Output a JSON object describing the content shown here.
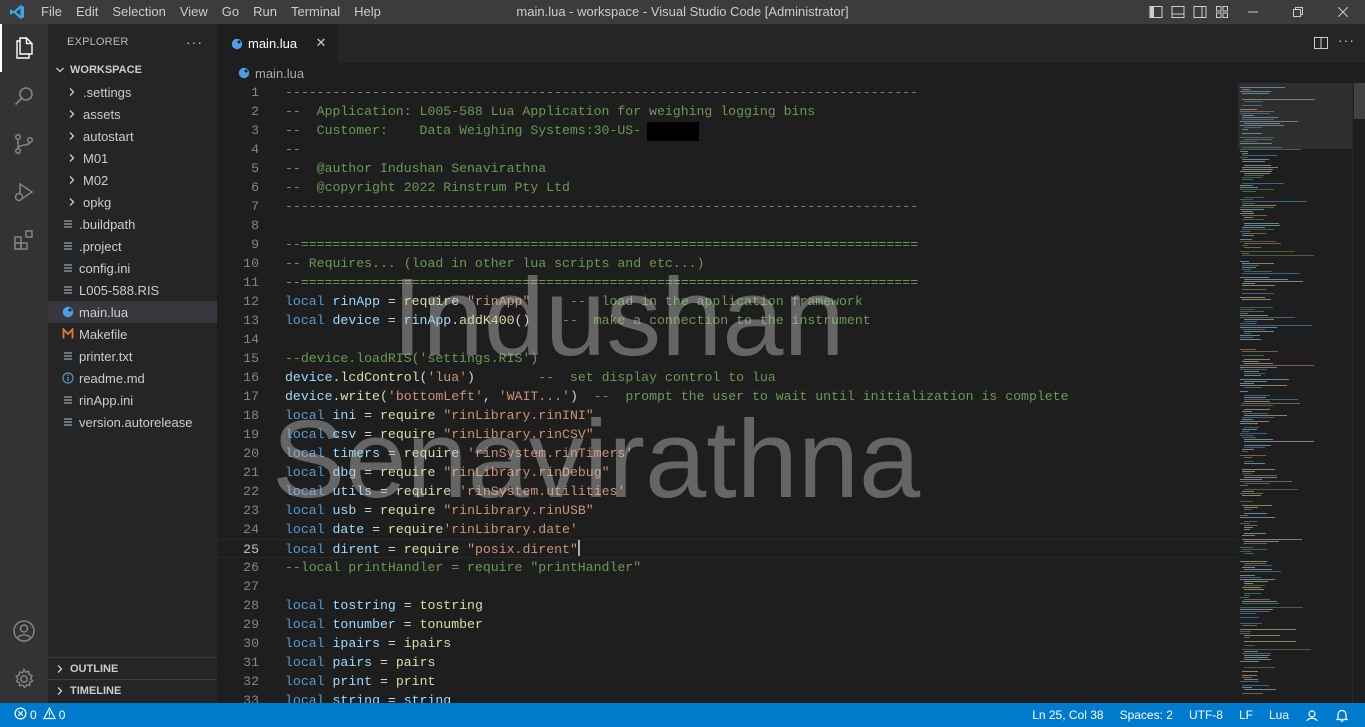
{
  "window": {
    "title": "main.lua - workspace - Visual Studio Code [Administrator]",
    "menus": [
      "File",
      "Edit",
      "Selection",
      "View",
      "Go",
      "Run",
      "Terminal",
      "Help"
    ]
  },
  "sidebar": {
    "title": "EXPLORER",
    "more": "···",
    "workspace_label": "WORKSPACE",
    "items": [
      {
        "label": ".settings",
        "kind": "folder"
      },
      {
        "label": "assets",
        "kind": "folder"
      },
      {
        "label": "autostart",
        "kind": "folder"
      },
      {
        "label": "M01",
        "kind": "folder"
      },
      {
        "label": "M02",
        "kind": "folder"
      },
      {
        "label": "opkg",
        "kind": "folder"
      },
      {
        "label": ".buildpath",
        "kind": "file"
      },
      {
        "label": ".project",
        "kind": "file"
      },
      {
        "label": "config.ini",
        "kind": "file"
      },
      {
        "label": "L005-588.RIS",
        "kind": "file"
      },
      {
        "label": "main.lua",
        "kind": "lua"
      },
      {
        "label": "Makefile",
        "kind": "makefile"
      },
      {
        "label": "printer.txt",
        "kind": "file"
      },
      {
        "label": "readme.md",
        "kind": "info"
      },
      {
        "label": "rinApp.ini",
        "kind": "file"
      },
      {
        "label": "version.autorelease",
        "kind": "file"
      }
    ],
    "outline_label": "OUTLINE",
    "timeline_label": "TIMELINE"
  },
  "tab": {
    "label": "main.lua"
  },
  "breadcrumb": {
    "file": "main.lua"
  },
  "editor": {
    "current_line": 25,
    "lines": [
      {
        "n": "1",
        "t": [
          [
            "cm",
            "--------------------------------------------------------------------------------"
          ]
        ]
      },
      {
        "n": "2",
        "t": [
          [
            "cm",
            "--  Application: L005-588 Lua Application for weighing logging bins"
          ]
        ]
      },
      {
        "n": "3",
        "t": [
          [
            "cm",
            "--  Customer:    Data Weighing Systems:30-US-"
          ]
        ]
      },
      {
        "n": "4",
        "t": [
          [
            "cm",
            "--"
          ]
        ]
      },
      {
        "n": "5",
        "t": [
          [
            "cm",
            "--  @author Indushan Senavirathna"
          ]
        ]
      },
      {
        "n": "6",
        "t": [
          [
            "cm",
            "--  @copyright 2022 Rinstrum Pty Ltd"
          ]
        ]
      },
      {
        "n": "7",
        "t": [
          [
            "cm",
            "--------------------------------------------------------------------------------"
          ]
        ]
      },
      {
        "n": "8",
        "t": []
      },
      {
        "n": "9",
        "t": [
          [
            "cm",
            "--=============================================================================="
          ]
        ]
      },
      {
        "n": "10",
        "t": [
          [
            "cm",
            "-- Requires... (load in other lua scripts and etc...)"
          ]
        ]
      },
      {
        "n": "11",
        "t": [
          [
            "cm",
            "--=============================================================================="
          ]
        ]
      },
      {
        "n": "12",
        "t": [
          [
            "kw",
            "local"
          ],
          [
            "tx",
            " "
          ],
          [
            "id",
            "rinApp"
          ],
          [
            "tx",
            " = "
          ],
          [
            "fn",
            "require"
          ],
          [
            "tx",
            " "
          ],
          [
            "st",
            "\"rinApp\""
          ],
          [
            "tx",
            "     "
          ],
          [
            "cm",
            "--  load in the application framework"
          ]
        ]
      },
      {
        "n": "13",
        "t": [
          [
            "kw",
            "local"
          ],
          [
            "tx",
            " "
          ],
          [
            "id",
            "device"
          ],
          [
            "tx",
            " = "
          ],
          [
            "id",
            "rinApp"
          ],
          [
            "tx",
            "."
          ],
          [
            "fn",
            "addK400"
          ],
          [
            "tx",
            "()    "
          ],
          [
            "cm",
            "--  make a connection to the instrument"
          ]
        ]
      },
      {
        "n": "14",
        "t": []
      },
      {
        "n": "15",
        "t": [
          [
            "cm",
            "--device.loadRIS('settings.RIS')"
          ]
        ]
      },
      {
        "n": "16",
        "t": [
          [
            "id",
            "device"
          ],
          [
            "tx",
            "."
          ],
          [
            "fn",
            "lcdControl"
          ],
          [
            "tx",
            "("
          ],
          [
            "st",
            "'lua'"
          ],
          [
            "tx",
            ")        "
          ],
          [
            "cm",
            "--  set display control to lua"
          ]
        ]
      },
      {
        "n": "17",
        "t": [
          [
            "id",
            "device"
          ],
          [
            "tx",
            "."
          ],
          [
            "fn",
            "write"
          ],
          [
            "tx",
            "("
          ],
          [
            "st",
            "'bottomLeft'"
          ],
          [
            "tx",
            ", "
          ],
          [
            "st",
            "'WAIT...'"
          ],
          [
            "tx",
            ")  "
          ],
          [
            "cm",
            "--  prompt the user to wait until initialization is complete"
          ]
        ]
      },
      {
        "n": "18",
        "t": [
          [
            "kw",
            "local"
          ],
          [
            "tx",
            " "
          ],
          [
            "id",
            "ini"
          ],
          [
            "tx",
            " = "
          ],
          [
            "fn",
            "require"
          ],
          [
            "tx",
            " "
          ],
          [
            "st",
            "\"rinLibrary.rinINI\""
          ]
        ]
      },
      {
        "n": "19",
        "t": [
          [
            "kw",
            "local"
          ],
          [
            "tx",
            " "
          ],
          [
            "id",
            "csv"
          ],
          [
            "tx",
            " = "
          ],
          [
            "fn",
            "require"
          ],
          [
            "tx",
            " "
          ],
          [
            "st",
            "\"rinLibrary.rinCSV\""
          ]
        ]
      },
      {
        "n": "20",
        "t": [
          [
            "kw",
            "local"
          ],
          [
            "tx",
            " "
          ],
          [
            "id",
            "timers"
          ],
          [
            "tx",
            " = "
          ],
          [
            "fn",
            "require"
          ],
          [
            "tx",
            " "
          ],
          [
            "st",
            "'rinSystem.rinTimers'"
          ]
        ]
      },
      {
        "n": "21",
        "t": [
          [
            "kw",
            "local"
          ],
          [
            "tx",
            " "
          ],
          [
            "id",
            "dbg"
          ],
          [
            "tx",
            " = "
          ],
          [
            "fn",
            "require"
          ],
          [
            "tx",
            " "
          ],
          [
            "st",
            "\"rinLibrary.rinDebug\""
          ]
        ]
      },
      {
        "n": "22",
        "t": [
          [
            "kw",
            "local"
          ],
          [
            "tx",
            " "
          ],
          [
            "id",
            "utils"
          ],
          [
            "tx",
            " = "
          ],
          [
            "fn",
            "require"
          ],
          [
            "tx",
            " "
          ],
          [
            "st",
            "'rinSystem.utilities'"
          ]
        ]
      },
      {
        "n": "23",
        "t": [
          [
            "kw",
            "local"
          ],
          [
            "tx",
            " "
          ],
          [
            "id",
            "usb"
          ],
          [
            "tx",
            " = "
          ],
          [
            "fn",
            "require"
          ],
          [
            "tx",
            " "
          ],
          [
            "st",
            "\"rinLibrary.rinUSB\""
          ]
        ]
      },
      {
        "n": "24",
        "t": [
          [
            "kw",
            "local"
          ],
          [
            "tx",
            " "
          ],
          [
            "id",
            "date"
          ],
          [
            "tx",
            " = "
          ],
          [
            "fn",
            "require"
          ],
          [
            "st",
            "'rinLibrary.date'"
          ]
        ]
      },
      {
        "n": "25",
        "t": [
          [
            "kw",
            "local"
          ],
          [
            "tx",
            " "
          ],
          [
            "id",
            "dirent"
          ],
          [
            "tx",
            " = "
          ],
          [
            "fn",
            "require"
          ],
          [
            "tx",
            " "
          ],
          [
            "st",
            "\"posix.dirent\""
          ]
        ]
      },
      {
        "n": "26",
        "t": [
          [
            "cm",
            "--local printHandler = require \"printHandler\""
          ]
        ]
      },
      {
        "n": "27",
        "t": []
      },
      {
        "n": "28",
        "t": [
          [
            "kw",
            "local"
          ],
          [
            "tx",
            " "
          ],
          [
            "id",
            "tostring"
          ],
          [
            "tx",
            " = "
          ],
          [
            "fn",
            "tostring"
          ]
        ]
      },
      {
        "n": "29",
        "t": [
          [
            "kw",
            "local"
          ],
          [
            "tx",
            " "
          ],
          [
            "id",
            "tonumber"
          ],
          [
            "tx",
            " = "
          ],
          [
            "fn",
            "tonumber"
          ]
        ]
      },
      {
        "n": "30",
        "t": [
          [
            "kw",
            "local"
          ],
          [
            "tx",
            " "
          ],
          [
            "id",
            "ipairs"
          ],
          [
            "tx",
            " = "
          ],
          [
            "fn",
            "ipairs"
          ]
        ]
      },
      {
        "n": "31",
        "t": [
          [
            "kw",
            "local"
          ],
          [
            "tx",
            " "
          ],
          [
            "id",
            "pairs"
          ],
          [
            "tx",
            " = "
          ],
          [
            "fn",
            "pairs"
          ]
        ]
      },
      {
        "n": "32",
        "t": [
          [
            "kw",
            "local"
          ],
          [
            "tx",
            " "
          ],
          [
            "id",
            "print"
          ],
          [
            "tx",
            " = "
          ],
          [
            "fn",
            "print"
          ]
        ]
      },
      {
        "n": "33",
        "t": [
          [
            "kw",
            "local"
          ],
          [
            "tx",
            " "
          ],
          [
            "id",
            "string"
          ],
          [
            "tx",
            " = "
          ],
          [
            "id",
            "string"
          ]
        ]
      }
    ]
  },
  "watermark": {
    "line1": "Indushan",
    "line2": "Senavirathna"
  },
  "statusbar": {
    "errors": "0",
    "warnings": "0",
    "position": "Ln 25, Col 38",
    "spaces": "Spaces: 2",
    "encoding": "UTF-8",
    "eol": "LF",
    "language": "Lua"
  },
  "colors": {
    "accent": "#007acc",
    "titlebar": "#3c3c3c",
    "activitybar": "#333333",
    "sidebar": "#252526",
    "editor": "#1e1e1e"
  }
}
